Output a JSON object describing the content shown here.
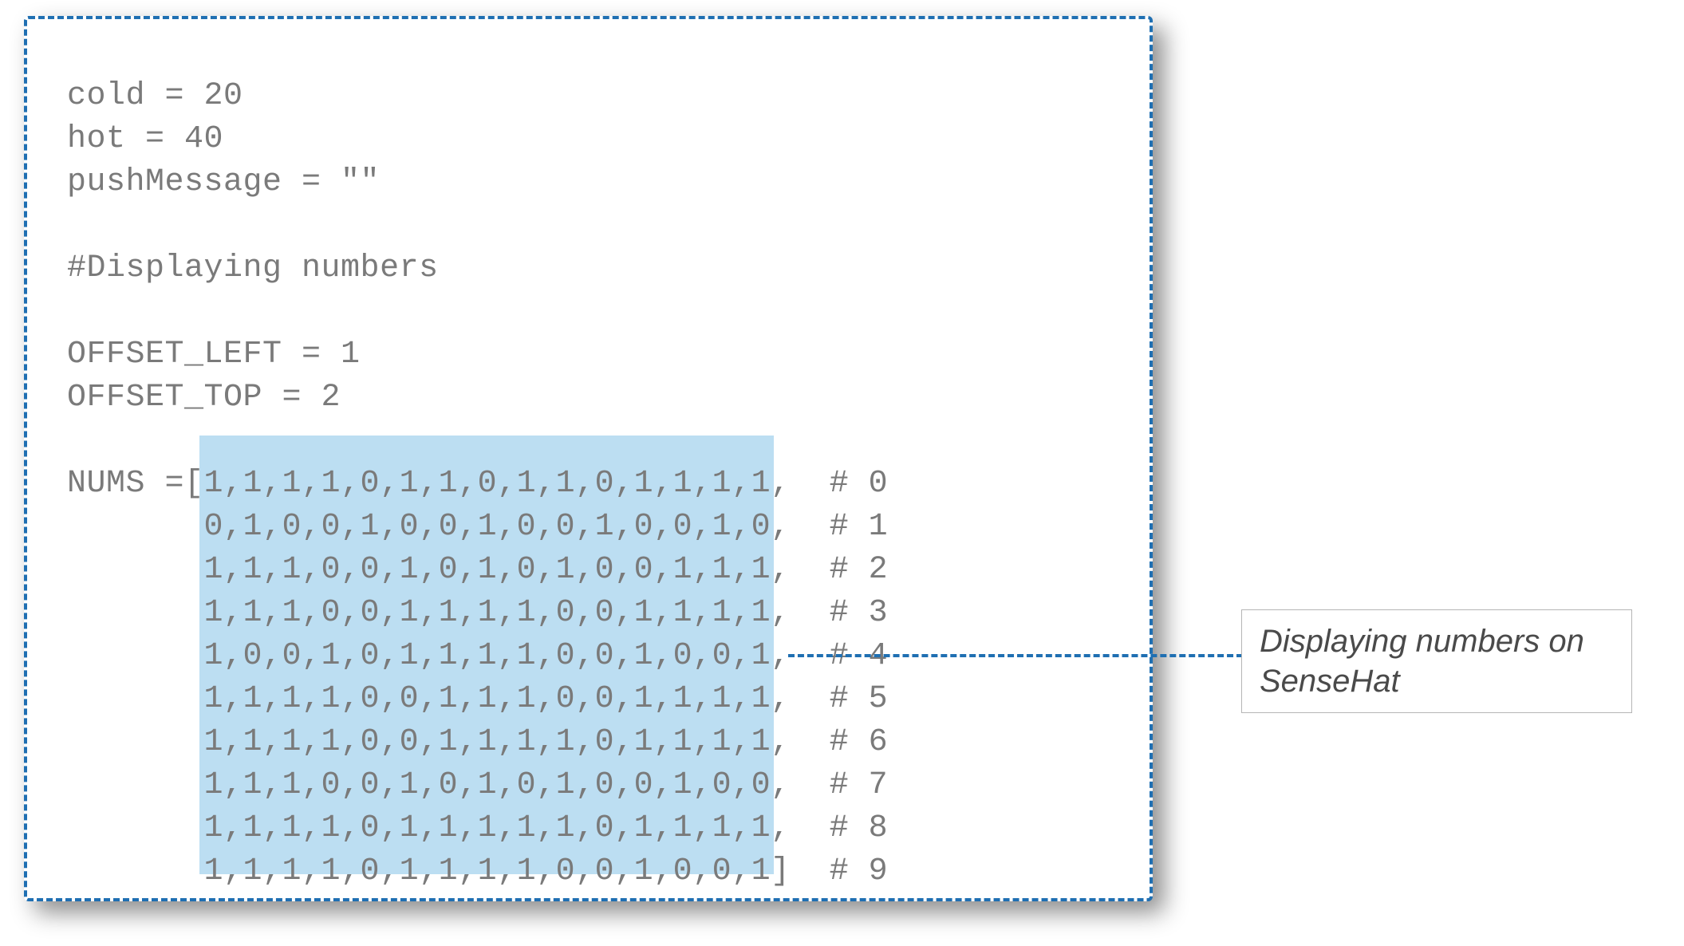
{
  "code": {
    "before_nums": "cold = 20\nhot = 40\npushMessage = \"\"\n\n#Displaying numbers\n\nOFFSET_LEFT = 1\nOFFSET_TOP = 2\n",
    "nums_prefix": "NUMS =[",
    "nums_indent": "       ",
    "nums_rows": [
      {
        "data": "1,1,1,1,0,1,1,0,1,1,0,1,1,1,1,",
        "comment": "  # 0"
      },
      {
        "data": "0,1,0,0,1,0,0,1,0,0,1,0,0,1,0,",
        "comment": "  # 1"
      },
      {
        "data": "1,1,1,0,0,1,0,1,0,1,0,0,1,1,1,",
        "comment": "  # 2"
      },
      {
        "data": "1,1,1,0,0,1,1,1,1,0,0,1,1,1,1,",
        "comment": "  # 3"
      },
      {
        "data": "1,0,0,1,0,1,1,1,1,0,0,1,0,0,1,",
        "comment": "  # 4"
      },
      {
        "data": "1,1,1,1,0,0,1,1,1,0,0,1,1,1,1,",
        "comment": "  # 5"
      },
      {
        "data": "1,1,1,1,0,0,1,1,1,1,0,1,1,1,1,",
        "comment": "  # 6"
      },
      {
        "data": "1,1,1,0,0,1,0,1,0,1,0,0,1,0,0,",
        "comment": "  # 7"
      },
      {
        "data": "1,1,1,1,0,1,1,1,1,1,0,1,1,1,1,",
        "comment": "  # 8"
      },
      {
        "data": "1,1,1,1,0,1,1,1,1,0,0,1,0,0,1]",
        "comment": "  # 9"
      }
    ]
  },
  "annotation": {
    "text": "Displaying numbers on SenseHat"
  },
  "colors": {
    "dashed_border": "#1f6fb2",
    "highlight": "#bcdef2",
    "code_text": "#7a7a7a"
  }
}
